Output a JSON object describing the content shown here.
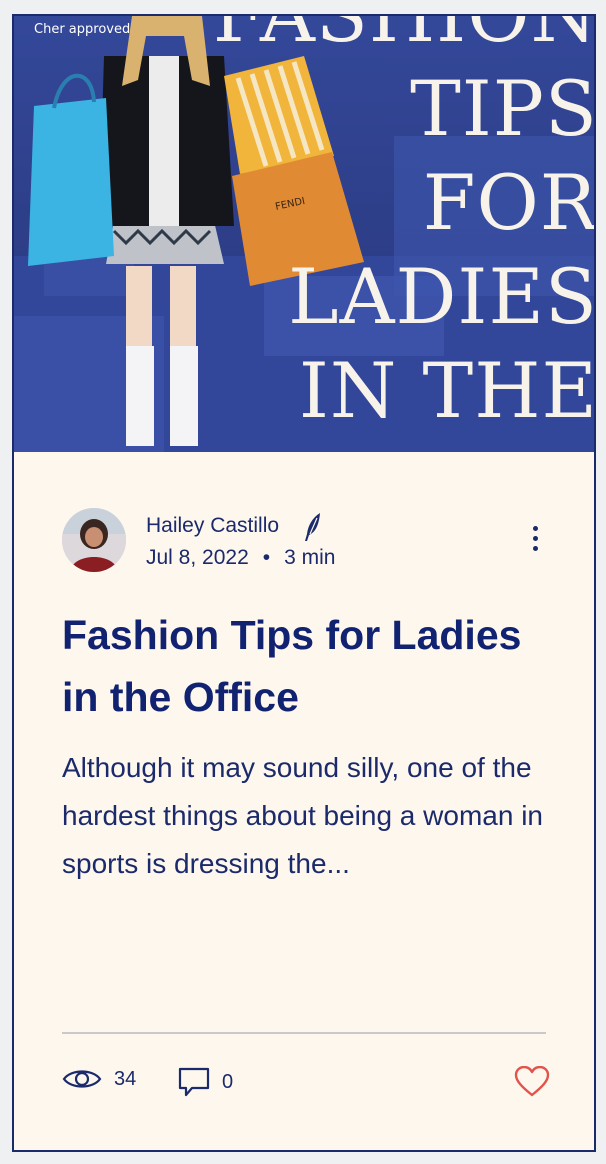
{
  "cover": {
    "caption": "Cher approved",
    "title_lines": [
      "FASHION",
      "TIPS",
      "FOR",
      "LADIES",
      "IN THE"
    ]
  },
  "post": {
    "author": "Hailey Castillo",
    "date": "Jul 8, 2022",
    "separator": "•",
    "read_time": "3 min",
    "title": "Fashion Tips for Ladies in the Office",
    "excerpt": "Although it may sound silly, one of the hardest things about being a woman in sports is dressing the..."
  },
  "stats": {
    "views": "34",
    "comments": "0"
  },
  "colors": {
    "navy": "#1b2a6b",
    "cover_blue": "#2e3f8a",
    "card_bg": "#fdf7ee",
    "like": "#e2544b"
  },
  "icons": {
    "author_badge": "quill-icon",
    "more": "more-options-icon",
    "views": "eye-icon",
    "comments": "comment-icon",
    "like": "heart-icon"
  }
}
